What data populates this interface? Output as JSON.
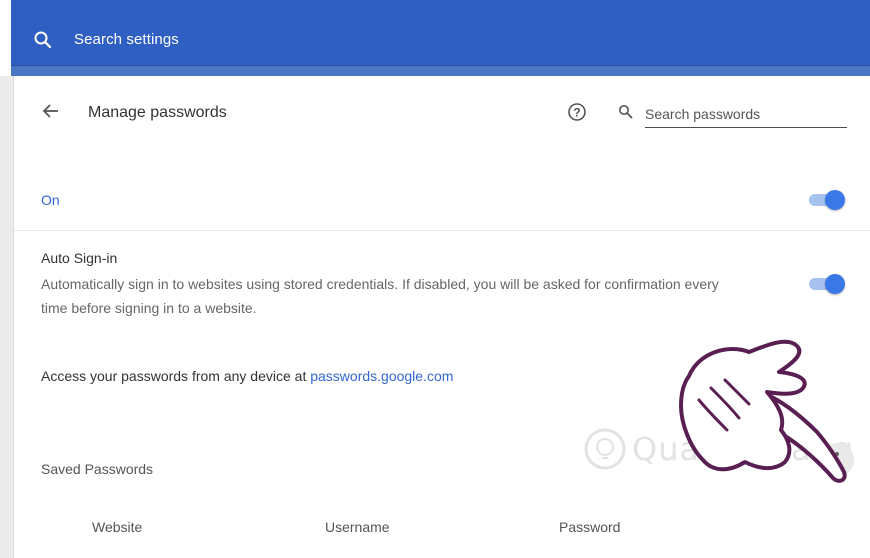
{
  "header": {
    "search_placeholder": "Search settings"
  },
  "page": {
    "title": "Manage passwords",
    "search_placeholder": "Search passwords"
  },
  "password_saving": {
    "label": "On",
    "enabled": true
  },
  "auto_signin": {
    "title": "Auto Sign-in",
    "description": "Automatically sign in to websites using stored credentials. If disabled, you will be asked for confirmation every time before signing in to a website.",
    "enabled": true
  },
  "access": {
    "text": "Access your passwords from any device at ",
    "link_text": "passwords.google.com"
  },
  "saved_passwords": {
    "title": "Saved Passwords",
    "columns": [
      "Website",
      "Username",
      "Password"
    ]
  },
  "watermark": {
    "text": "Quantrimang"
  },
  "colors": {
    "header_blue": "#2f5fc2",
    "accent": "#3367d6",
    "toggle_on": "#3b78e7"
  },
  "icons": {
    "search": "search-icon",
    "back": "arrow-back-icon",
    "help": "help-circle-icon",
    "more": "more-vert-icon"
  }
}
